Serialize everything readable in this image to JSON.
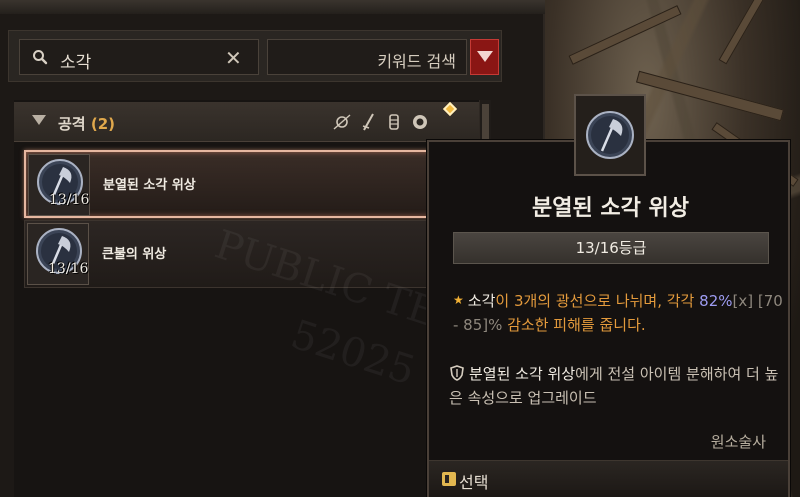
{
  "search": {
    "value": "소각",
    "clear_symbol": "✕",
    "keyword_label": "키워드 검색"
  },
  "category": {
    "title": "공격",
    "count": "(2)"
  },
  "items": [
    {
      "name": "분열된 소각 위상",
      "level": "13/16"
    },
    {
      "name": "큰불의 위상",
      "level": "13/16"
    }
  ],
  "watermark": {
    "line1": "PUBLIC TEST",
    "line2": "52025"
  },
  "tooltip": {
    "title": "분열된 소각 위상",
    "grade": "13/16등급",
    "desc": {
      "star": "★",
      "p1": "소각",
      "p2": "이 3개의 광선으로 나뉘며, 각각",
      "p3": "82%",
      "p4": "[x]",
      "p5": " [70 - 85]% ",
      "p6": "감소한 피해를 줍니다."
    },
    "note": {
      "p1": "분열된 소각 위상",
      "p2": "에게 전설 아이템 분해하여 더 높은 속성으로 업그레이드"
    },
    "class_name": "원소술사",
    "footer_label": "선택"
  },
  "colors": {
    "accent_orange": "#e39a3c",
    "accent_blue": "#9e9cf2",
    "selected_border": "#e6b7a0",
    "dropdown_red": "#8a1614"
  },
  "icons": [
    "search-icon",
    "clear-icon",
    "chevron-down-icon",
    "staff-icon",
    "dagger-icon",
    "gauntlet-icon",
    "focus-icon",
    "axe-orb-icon",
    "shield-icon",
    "select-icon"
  ]
}
